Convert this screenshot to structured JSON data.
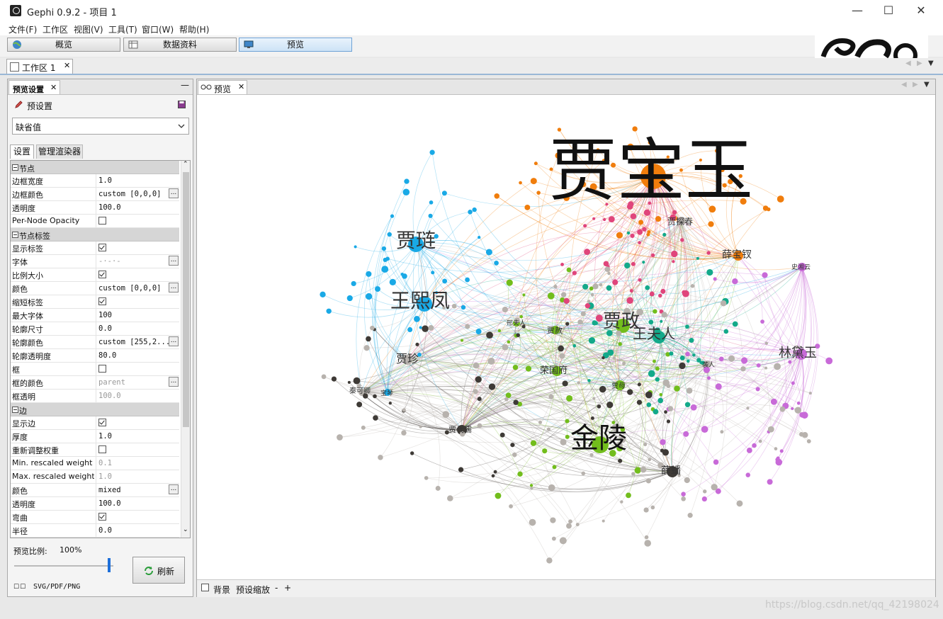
{
  "window": {
    "title": "Gephi 0.9.2 - 项目 1",
    "minimize": "—",
    "maximize": "☐",
    "close": "✕"
  },
  "menu": [
    "文件(F)",
    "工作区",
    "视图(V)",
    "工具(T)",
    "窗口(W)",
    "帮助(H)"
  ],
  "modes": [
    {
      "label": "概览",
      "icon": "globe-icon"
    },
    {
      "label": "数据资料",
      "icon": "table-icon"
    },
    {
      "label": "预览",
      "icon": "monitor-icon",
      "active": true
    }
  ],
  "workspace_tab": {
    "label": "工作区 1",
    "close": "✕"
  },
  "left_panel": {
    "tab_label": "预览设置",
    "tab_close": "✕",
    "minimize": "—",
    "preset_header": "预设置",
    "preset_value": "缺省值",
    "subtabs": [
      "设置",
      "管理渲染器"
    ],
    "preview_ratio_label": "预览比例:",
    "preview_ratio_value": "100%",
    "refresh_label": "刷新",
    "export_label": "SVG/PDF/PNG",
    "properties": [
      {
        "type": "category",
        "name": "节点"
      },
      {
        "name": "边框宽度",
        "value": "1.0"
      },
      {
        "name": "边框颜色",
        "value": "custom [0,0,0]",
        "dots": true
      },
      {
        "name": "透明度",
        "value": "100.0"
      },
      {
        "name": "Per-Node Opacity",
        "checkbox": false
      },
      {
        "type": "category",
        "name": "节点标签"
      },
      {
        "name": "显示标签",
        "checkbox": true
      },
      {
        "name": "字体",
        "value": "-·-·-",
        "dots": true,
        "disabled": true
      },
      {
        "name": "比例大小",
        "checkbox": true
      },
      {
        "name": "颜色",
        "value": "custom [0,0,0]",
        "dots": true
      },
      {
        "name": "缩短标签",
        "checkbox": true
      },
      {
        "name": "最大字体",
        "value": "100"
      },
      {
        "name": "轮廓尺寸",
        "value": "0.0"
      },
      {
        "name": "轮廓颜色",
        "value": "custom [255,2...",
        "dots": true
      },
      {
        "name": "轮廓透明度",
        "value": "80.0"
      },
      {
        "name": "框",
        "checkbox": false
      },
      {
        "name": "框的颜色",
        "value": "parent",
        "dots": true,
        "disabled": true
      },
      {
        "name": "框透明",
        "value": "100.0",
        "disabled": true
      },
      {
        "type": "category",
        "name": "边"
      },
      {
        "name": "显示边",
        "checkbox": true
      },
      {
        "name": "厚度",
        "value": "1.0"
      },
      {
        "name": "重新调整权重",
        "checkbox": false
      },
      {
        "name": "Min. rescaled weight",
        "value": "0.1",
        "disabled": true
      },
      {
        "name": "Max. rescaled weight",
        "value": "1.0",
        "disabled": true
      },
      {
        "name": "颜色",
        "value": "mixed",
        "dots": true
      },
      {
        "name": "透明度",
        "value": "100.0"
      },
      {
        "name": "弯曲",
        "checkbox": true
      },
      {
        "name": "半径",
        "value": "0.0"
      }
    ]
  },
  "preview_panel": {
    "tab_label": "预览",
    "tab_close": "✕",
    "background_label": "背景",
    "zoom_label": "预设缩放",
    "zoom_minus": "-",
    "zoom_plus": "+"
  },
  "graph": {
    "colors": {
      "orange": "#f07d0c",
      "blue": "#19a9e6",
      "green": "#72bd1c",
      "teal": "#13a98a",
      "pink": "#e0457b",
      "purple": "#c86ad8",
      "dark": "#3e3a36",
      "gray": "#b7b2ad"
    },
    "labels": [
      {
        "text": "贾宝玉",
        "size": 96,
        "color": "orange"
      },
      {
        "text": "贾琏",
        "size": 28,
        "color": "blue"
      },
      {
        "text": "王熙凤",
        "size": 28,
        "color": "blue"
      },
      {
        "text": "贾政",
        "size": 26,
        "color": "green"
      },
      {
        "text": "王夫人",
        "size": 20,
        "color": "teal"
      },
      {
        "text": "林黛玉",
        "size": 18,
        "color": "purple"
      },
      {
        "text": "金陵",
        "size": 40,
        "color": "green"
      },
      {
        "text": "薛宝钗",
        "size": 14,
        "color": "orange"
      },
      {
        "text": "贾探春",
        "size": 12,
        "color": "gray"
      },
      {
        "text": "贾珍",
        "size": 16,
        "color": "gray"
      },
      {
        "text": "荣国府",
        "size": 13,
        "color": "green"
      },
      {
        "text": "贾赦",
        "size": 11,
        "color": "green"
      },
      {
        "text": "贾母",
        "size": 10,
        "color": "green"
      },
      {
        "text": "薛蟠",
        "size": 14,
        "color": "dark"
      },
      {
        "text": "贾代儒",
        "size": 11,
        "color": "dark"
      },
      {
        "text": "秦可卿",
        "size": 10,
        "color": "gray"
      },
      {
        "text": "邢夫人",
        "size": 9,
        "color": "green"
      },
      {
        "text": "史湘云",
        "size": 9,
        "color": "purple"
      },
      {
        "text": "袭人",
        "size": 9,
        "color": "gray"
      },
      {
        "text": "宝琴",
        "size": 9,
        "color": "gray"
      }
    ]
  },
  "watermark": "https://blog.csdn.net/qq_42198024"
}
